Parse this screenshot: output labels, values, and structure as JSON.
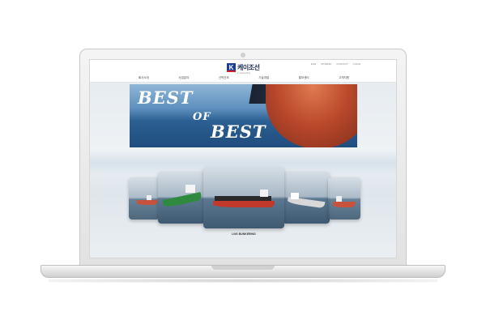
{
  "header": {
    "utility_links": [
      "ENG",
      "SITEMAP",
      "CONTACT",
      "LOGIN"
    ],
    "logo": {
      "mark": "K",
      "name": "케이조선",
      "subtitle": "K Shipbuilding"
    },
    "nav": [
      "회사소개",
      "사업분야",
      "선박건조",
      "기술개발",
      "홍보센터",
      "고객지원"
    ]
  },
  "banner": {
    "slogan": [
      "BEST",
      "OF",
      "BEST"
    ]
  },
  "carousel": {
    "caption": "LNG BUNKERING",
    "active_index": 2
  },
  "colors": {
    "brand_navy": "#1d3f8f",
    "brand_red": "#d21f2b",
    "hull_red": "#b8482a"
  }
}
